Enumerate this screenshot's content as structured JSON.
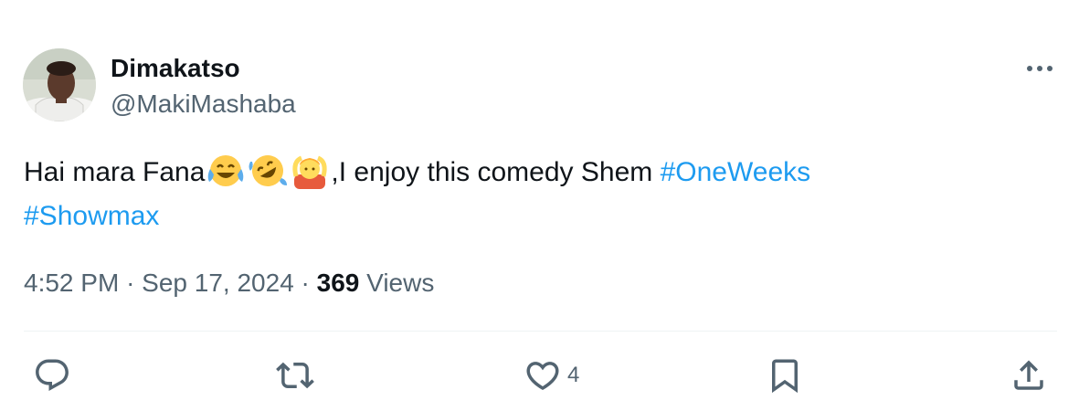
{
  "author": {
    "display_name": "Dimakatso",
    "handle": "@MakiMashaba",
    "avatar_icon": "profile-photo"
  },
  "tweet": {
    "text_before_emoji": "Hai mara Fana",
    "emojis": [
      "face-with-tears-of-joy",
      "rolling-on-the-floor-laughing",
      "person-gesturing-ok"
    ],
    "text_after_emoji": ",I enjoy this comedy Shem ",
    "hashtags": [
      "#OneWeeks",
      "#Showmax"
    ]
  },
  "meta": {
    "time": "4:52 PM",
    "separator": "·",
    "date": "Sep 17, 2024",
    "views_count": "369",
    "views_label": "Views"
  },
  "actions": {
    "reply_icon": "reply-icon",
    "retweet_icon": "retweet-icon",
    "like_icon": "heart-icon",
    "like_count": "4",
    "bookmark_icon": "bookmark-icon",
    "share_icon": "share-icon"
  },
  "colors": {
    "link": "#1d9bf0",
    "secondary_text": "#536471",
    "primary_text": "#0f1419",
    "divider": "#eff3f4"
  }
}
